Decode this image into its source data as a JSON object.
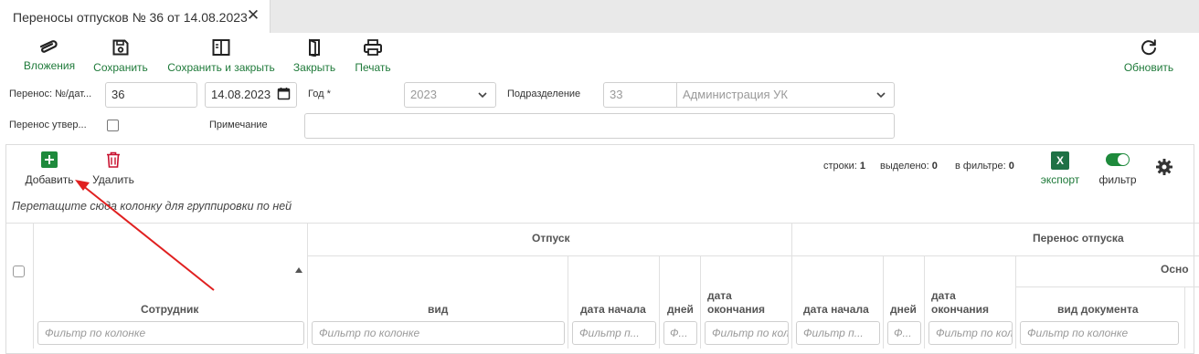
{
  "tab": {
    "title": "Переносы отпусков № 36 от 14.08.2023",
    "close": "✕"
  },
  "toolbar": {
    "attachments": "Вложения",
    "save": "Сохранить",
    "save_close": "Сохранить и закрыть",
    "close": "Закрыть",
    "print": "Печать",
    "refresh": "Обновить"
  },
  "form": {
    "transfer_label": "Перенос: №/дат...",
    "number_value": "36",
    "date_value": "14.08.2023",
    "year_label": "Год *",
    "year_value": "2023",
    "department_label": "Подразделение",
    "department_code": "33",
    "department_name": "Администрация УК",
    "approved_label": "Перенос утвер...",
    "note_label": "Примечание",
    "note_value": ""
  },
  "grid_toolbar": {
    "add": "Добавить",
    "delete": "Удалить",
    "rows_label": "строки:",
    "rows_value": "1",
    "selected_label": "выделено:",
    "selected_value": "0",
    "in_filter_label": "в фильтре:",
    "in_filter_value": "0",
    "export": "экспорт",
    "export_icon_text": "X",
    "filter": "фильтр"
  },
  "grid": {
    "group_hint": "Перетащите сюда колонку для группировки по ней",
    "groups": {
      "vacation": "Отпуск",
      "transfer": "Перенос отпуска",
      "basis": "Осно"
    },
    "columns": {
      "employee": "Сотрудник",
      "type": "вид",
      "start_date": "дата начала",
      "days": "дней",
      "end_date_1": "дата",
      "end_date_2": "окончания",
      "start_date_2": "дата начала",
      "days_2": "дней",
      "end_date_b1": "дата",
      "end_date_b2": "окончания",
      "doc_type": "вид документа"
    },
    "filters": {
      "employee": "Фильтр по колонке",
      "type": "Фильтр по колонке",
      "start_date": "Фильтр п...",
      "days": "Ф...",
      "end_date": "Фильтр по колонке",
      "start_date_2": "Фильтр п...",
      "days_2": "Ф...",
      "end_date_2": "Фильтр по колонке",
      "doc_type": "Фильтр по колонке"
    }
  },
  "colors": {
    "accent_green": "#1f7a3a",
    "excel_green": "#1e7145",
    "delete_red": "#c8102e",
    "annotation_red": "#e02020"
  }
}
